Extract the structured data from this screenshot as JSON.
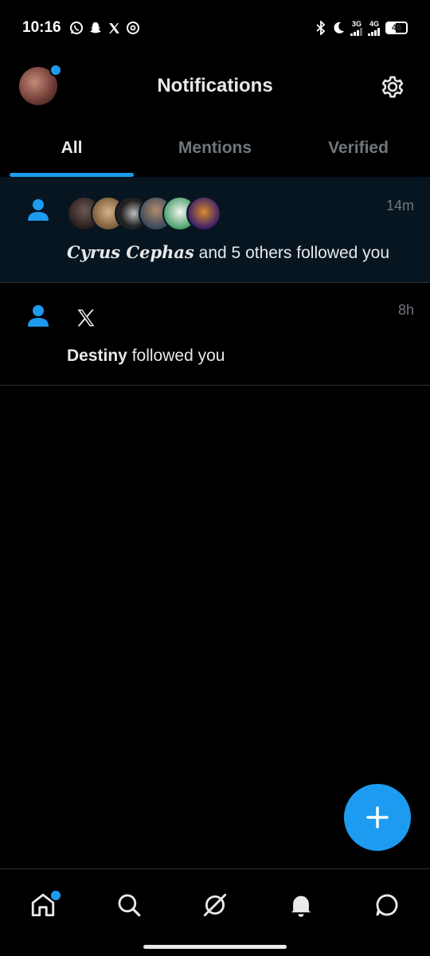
{
  "status_bar": {
    "time": "10:16",
    "network_1": "3G",
    "network_2": "4G",
    "battery": "46"
  },
  "header": {
    "title": "Notifications"
  },
  "tabs": [
    {
      "label": "All",
      "active": true
    },
    {
      "label": "Mentions",
      "active": false
    },
    {
      "label": "Verified",
      "active": false
    }
  ],
  "notifications": [
    {
      "name": "Cyrus Cephas",
      "text": " and 5 others followed you",
      "time": "14m"
    },
    {
      "name": "Destiny",
      "text": " followed you",
      "time": "8h"
    }
  ],
  "colors": {
    "accent": "#1d9bf0",
    "background": "#000000",
    "highlight": "#061520",
    "muted": "#71767b"
  },
  "icons": [
    "whatsapp-icon",
    "snapchat-icon",
    "x-icon",
    "threads-icon",
    "bluetooth-icon",
    "moon-icon",
    "gear-icon",
    "person-icon",
    "x-logo-icon",
    "plus-icon",
    "home-icon",
    "search-icon",
    "grok-icon",
    "bell-icon",
    "messages-icon"
  ]
}
